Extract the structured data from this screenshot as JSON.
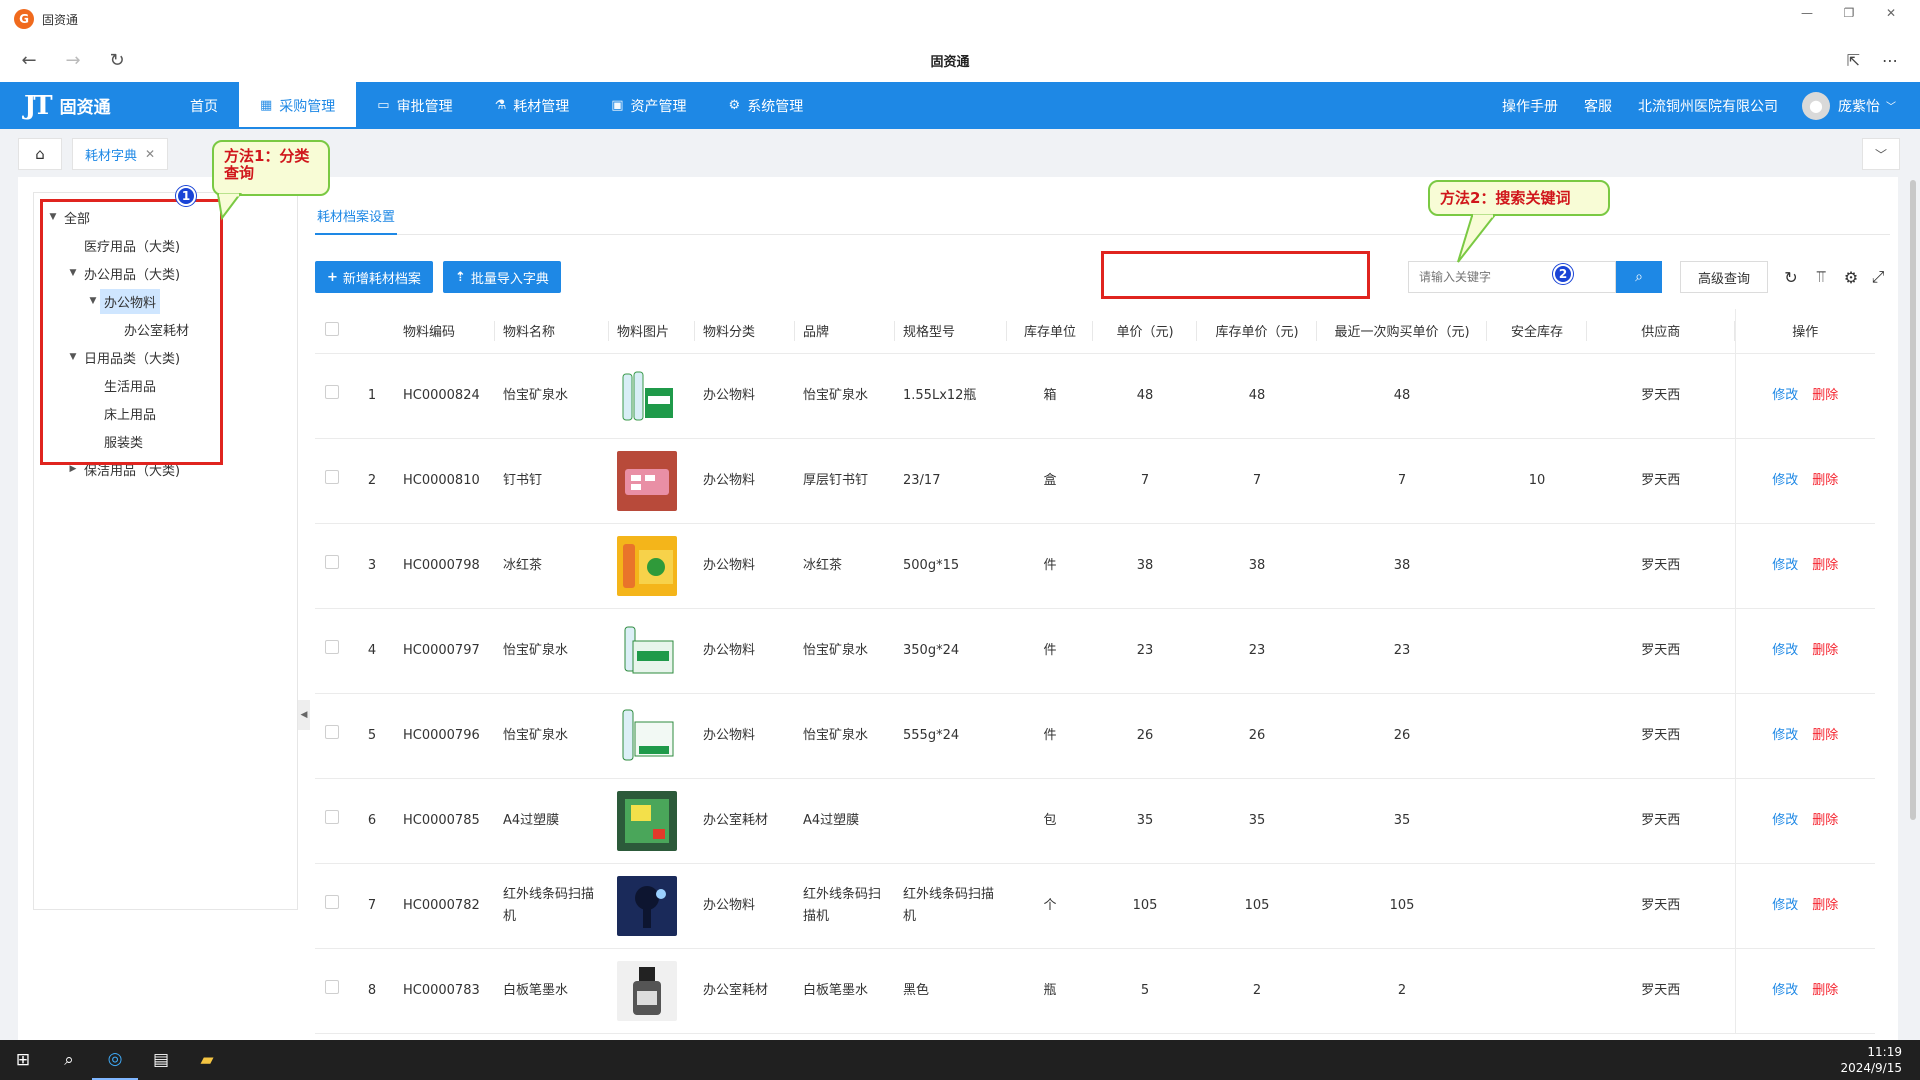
{
  "window": {
    "app_name": "固资通",
    "logo_letter": "G",
    "page_title": "固资通"
  },
  "header": {
    "brand_logo": "JT",
    "brand_name": "固资通",
    "nav": [
      {
        "label": "首页",
        "icon": ""
      },
      {
        "label": "采购管理",
        "icon": "grid-icon"
      },
      {
        "label": "审批管理",
        "icon": "monitor-icon"
      },
      {
        "label": "耗材管理",
        "icon": "flask-icon"
      },
      {
        "label": "资产管理",
        "icon": "calendar-icon"
      },
      {
        "label": "系统管理",
        "icon": "gear-icon"
      }
    ],
    "active_nav": "采购管理",
    "manual": "操作手册",
    "service": "客服",
    "company": "北流铜州医院有限公司",
    "user": "庞紫怡"
  },
  "tabs": {
    "current": "耗材字典"
  },
  "tree": {
    "nodes": [
      {
        "label": "全部",
        "level": 0,
        "expanded": true
      },
      {
        "label": "医疗用品（大类)",
        "level": 1,
        "leaf": true
      },
      {
        "label": "办公用品（大类)",
        "level": 1,
        "expanded": true
      },
      {
        "label": "办公物料",
        "level": 2,
        "expanded": true,
        "selected": true
      },
      {
        "label": "办公室耗材",
        "level": 3,
        "leaf": true
      },
      {
        "label": "日用品类（大类)",
        "level": 1,
        "expanded": true
      },
      {
        "label": "生活用品",
        "level": 2,
        "leaf": true
      },
      {
        "label": "床上用品",
        "level": 2,
        "leaf": true
      },
      {
        "label": "服装类",
        "level": 2,
        "leaf": true
      },
      {
        "label": "保洁用品（大类)",
        "level": 1,
        "expanded": false
      }
    ]
  },
  "annotations": {
    "method1": "方法1：分类查询",
    "method2": "方法2：搜索关键词",
    "badge1": "1",
    "badge2": "2"
  },
  "content": {
    "tab": "耗材档案设置",
    "add_button": "新增耗材档案",
    "import_button": "批量导入字典",
    "search_placeholder": "请输入关键字",
    "advanced_button": "高级查询"
  },
  "table": {
    "columns": [
      "",
      "",
      "物料编码",
      "物料名称",
      "物料图片",
      "物料分类",
      "品牌",
      "规格型号",
      "库存单位",
      "单价（元)",
      "库存单价（元)",
      "最近一次购买单价（元)",
      "安全库存",
      "供应商",
      "操作"
    ],
    "edit_label": "修改",
    "delete_label": "删除",
    "rows": [
      {
        "no": "1",
        "code": "HC0000824",
        "name": "怡宝矿泉水",
        "image": "water-bottles",
        "category": "办公物料",
        "brand": "怡宝矿泉水",
        "spec": "1.55Lx12瓶",
        "unit": "箱",
        "price": "48",
        "stock_price": "48",
        "last_price": "48",
        "safety": "",
        "supplier": "罗天西"
      },
      {
        "no": "2",
        "code": "HC0000810",
        "name": "钉书钉",
        "image": "staples",
        "category": "办公物料",
        "brand": "厚层钉书钉",
        "spec": "23/17",
        "unit": "盒",
        "price": "7",
        "stock_price": "7",
        "last_price": "7",
        "safety": "10",
        "supplier": "罗天西"
      },
      {
        "no": "3",
        "code": "HC0000798",
        "name": "冰红茶",
        "image": "ice-tea",
        "category": "办公物料",
        "brand": "冰红茶",
        "spec": "500g*15",
        "unit": "件",
        "price": "38",
        "stock_price": "38",
        "last_price": "38",
        "safety": "",
        "supplier": "罗天西"
      },
      {
        "no": "4",
        "code": "HC0000797",
        "name": "怡宝矿泉水",
        "image": "water-pack",
        "category": "办公物料",
        "brand": "怡宝矿泉水",
        "spec": "350g*24",
        "unit": "件",
        "price": "23",
        "stock_price": "23",
        "last_price": "23",
        "safety": "",
        "supplier": "罗天西"
      },
      {
        "no": "5",
        "code": "HC0000796",
        "name": "怡宝矿泉水",
        "image": "water-pack-large",
        "category": "办公物料",
        "brand": "怡宝矿泉水",
        "spec": "555g*24",
        "unit": "件",
        "price": "26",
        "stock_price": "26",
        "last_price": "26",
        "safety": "",
        "supplier": "罗天西"
      },
      {
        "no": "6",
        "code": "HC0000785",
        "name": "A4过塑膜",
        "image": "laminating-film",
        "category": "办公室耗材",
        "brand": "A4过塑膜",
        "spec": "",
        "unit": "包",
        "price": "35",
        "stock_price": "35",
        "last_price": "35",
        "safety": "",
        "supplier": "罗天西"
      },
      {
        "no": "7",
        "code": "HC0000782",
        "name": "红外线条码扫描机",
        "image": "barcode-scanner",
        "category": "办公物料",
        "brand": "红外线条码扫描机",
        "spec": "红外线条码扫描机",
        "unit": "个",
        "price": "105",
        "stock_price": "105",
        "last_price": "105",
        "safety": "",
        "supplier": "罗天西"
      },
      {
        "no": "8",
        "code": "HC0000783",
        "name": "白板笔墨水",
        "image": "ink-bottle",
        "category": "办公室耗材",
        "brand": "白板笔墨水",
        "spec": "黑色",
        "unit": "瓶",
        "price": "5",
        "stock_price": "2",
        "last_price": "2",
        "safety": "",
        "supplier": "罗天西"
      }
    ]
  },
  "taskbar": {
    "time": "11:19",
    "date": "2024/9/15"
  },
  "colors": {
    "primary": "#1e88e5",
    "danger": "#f5222d",
    "highlight": "#e0241f",
    "callout_border": "#7ac943",
    "callout_bg": "#f8fcd6"
  }
}
